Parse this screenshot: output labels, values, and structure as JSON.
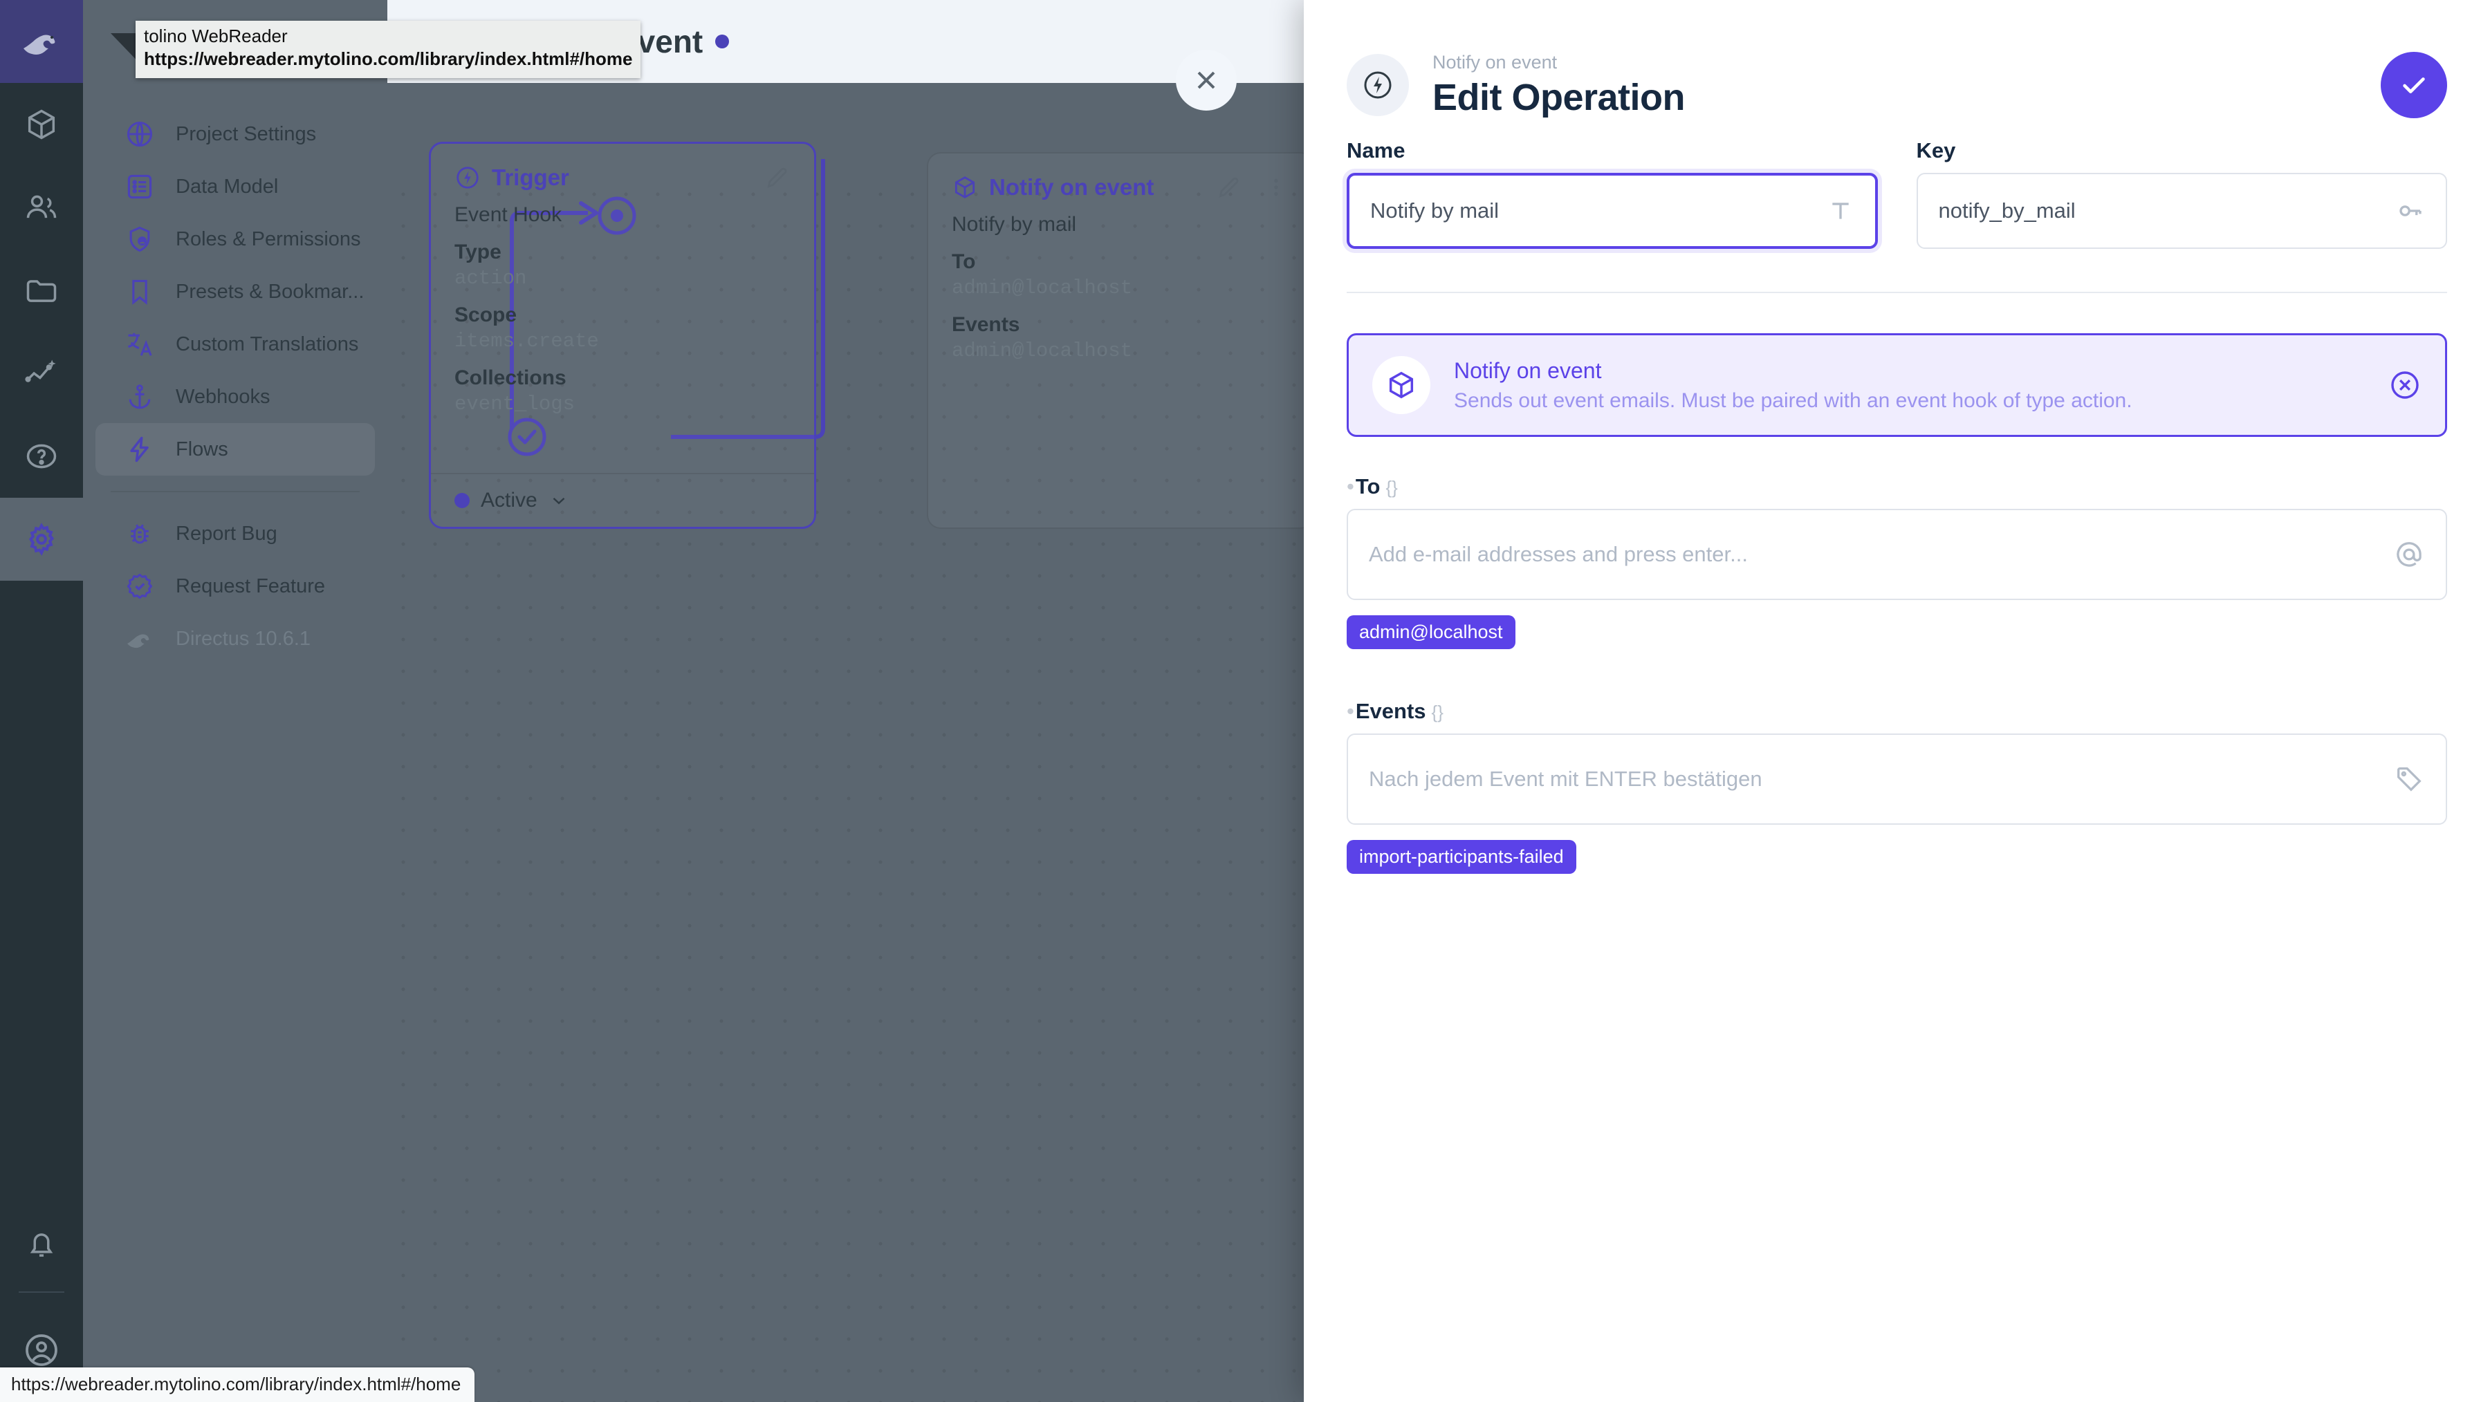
{
  "browser": {
    "link_tooltip_title": "tolino WebReader",
    "link_tooltip_url": "https://webreader.mytolino.com/library/index.html#/home",
    "status_bar_url": "https://webreader.mytolino.com/library/index.html#/home"
  },
  "module_rail": {
    "logo_icon": "directus-rabbit-logo-icon",
    "items": [
      {
        "icon": "box-icon",
        "name": "content",
        "active": false
      },
      {
        "icon": "users-icon",
        "name": "user-directory",
        "active": false
      },
      {
        "icon": "folder-icon",
        "name": "file-library",
        "active": false
      },
      {
        "icon": "insights-icon",
        "name": "insights",
        "active": false
      },
      {
        "icon": "help-circle-icon",
        "name": "help",
        "active": false
      },
      {
        "icon": "gear-icon",
        "name": "settings",
        "active": true
      }
    ],
    "bottom": [
      {
        "icon": "bell-icon",
        "name": "notifications"
      },
      {
        "icon": "account-circle-icon",
        "name": "user-account"
      }
    ]
  },
  "sidebar": {
    "items": [
      {
        "label": "Project Settings",
        "icon": "globe-icon",
        "active": false
      },
      {
        "label": "Data Model",
        "icon": "list-box-icon",
        "active": false
      },
      {
        "label": "Roles & Permissions",
        "icon": "shield-account-icon",
        "active": false
      },
      {
        "label": "Presets & Bookmar...",
        "icon": "bookmark-icon",
        "active": false
      },
      {
        "label": "Custom Translations",
        "icon": "translate-icon",
        "active": false
      },
      {
        "label": "Webhooks",
        "icon": "anchor-icon",
        "active": false
      },
      {
        "label": "Flows",
        "icon": "bolt-icon",
        "active": true
      }
    ],
    "footer_items": [
      {
        "label": "Report Bug",
        "icon": "bug-icon"
      },
      {
        "label": "Request Feature",
        "icon": "badge-check-icon"
      }
    ],
    "version": {
      "label": "Directus 10.6.1",
      "icon": "directus-rabbit-icon"
    }
  },
  "flow_header": {
    "back_icon": "arrow-left-icon",
    "title": "Notify on event",
    "status_dot_color": "#4b42b8",
    "close_icon": "close-icon"
  },
  "canvas": {
    "nodes": [
      {
        "id": "trigger",
        "title": "Trigger",
        "icon": "flash-circle-icon",
        "edit_icon": "pencil-icon",
        "subtitle": "Event Hook",
        "fields": [
          {
            "label": "Type",
            "value": "action"
          },
          {
            "label": "Scope",
            "value": "items.create"
          },
          {
            "label": "Collections",
            "value": "event_logs"
          }
        ],
        "status": "Active",
        "status_chevron": "chevron-down-icon"
      },
      {
        "id": "notify-on-event",
        "title": "Notify on event",
        "icon": "cube-outline-icon",
        "edit_icon": "pencil-icon",
        "menu_icon": "dots-vertical-icon",
        "subtitle": "Notify by mail",
        "fields": [
          {
            "label": "To",
            "value": "admin@localhost"
          },
          {
            "label": "Events",
            "value": "admin@localhost"
          }
        ]
      }
    ]
  },
  "drawer": {
    "eyebrow": "Notify on event",
    "title": "Edit Operation",
    "header_icon": "flash-circle-icon",
    "save_icon": "check-icon",
    "name_field": {
      "label": "Name",
      "value": "Notify by mail",
      "suffix_icon": "text-format-icon",
      "focused": true
    },
    "key_field": {
      "label": "Key",
      "value": "notify_by_mail",
      "suffix_icon": "key-icon",
      "focused": false
    },
    "operation_card": {
      "icon": "cube-outline-icon",
      "title": "Notify on event",
      "description": "Sends out event emails. Must be paired with an event hook of type action.",
      "close_icon": "close-circle-icon",
      "accent": "#5b42e8"
    },
    "to_field": {
      "label": "To",
      "braces": "{}",
      "required_marker": "•",
      "placeholder": "Add e-mail addresses and press enter...",
      "value": "",
      "suffix_icon": "at-icon",
      "chips": [
        "admin@localhost"
      ]
    },
    "events_field": {
      "label": "Events",
      "braces": "{}",
      "required_marker": "•",
      "placeholder": "Nach jedem Event mit ENTER bestätigen",
      "value": "",
      "suffix_icon": "tag-icon",
      "chips": [
        "import-participants-failed"
      ]
    }
  }
}
